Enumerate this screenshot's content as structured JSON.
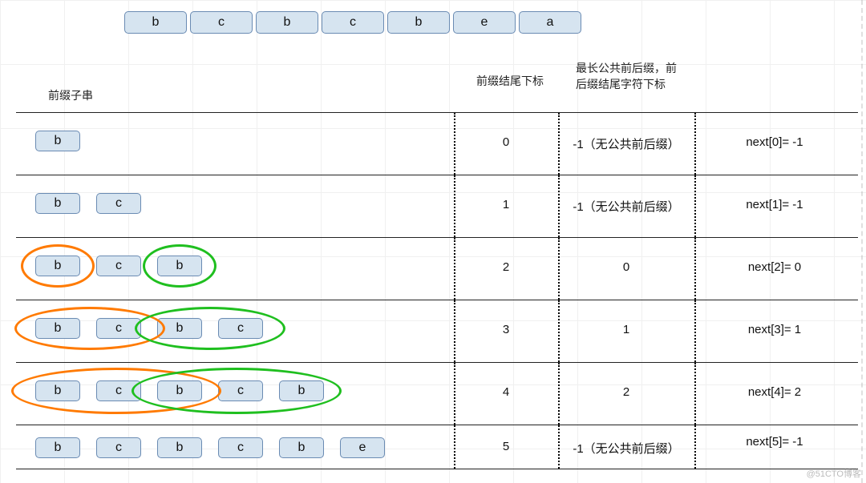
{
  "pattern": [
    "b",
    "c",
    "b",
    "c",
    "b",
    "e",
    "a"
  ],
  "headers": {
    "prefix": "前缀子串",
    "idx": "前缀结尾下标",
    "lps": "最长公共前后缀，前后缀结尾字符下标"
  },
  "rows": [
    {
      "cells": [
        "b"
      ],
      "idx": "0",
      "lps": "-1（无公共前后缀）",
      "next": "next[0]= -1"
    },
    {
      "cells": [
        "b",
        "c"
      ],
      "idx": "1",
      "lps": "-1（无公共前后缀）",
      "next": "next[1]= -1"
    },
    {
      "cells": [
        "b",
        "c",
        "b"
      ],
      "idx": "2",
      "lps": "0",
      "next": "next[2]= 0"
    },
    {
      "cells": [
        "b",
        "c",
        "b",
        "c"
      ],
      "idx": "3",
      "lps": "1",
      "next": "next[3]= 1"
    },
    {
      "cells": [
        "b",
        "c",
        "b",
        "c",
        "b"
      ],
      "idx": "4",
      "lps": "2",
      "next": "next[4]= 2"
    },
    {
      "cells": [
        "b",
        "c",
        "b",
        "c",
        "b",
        "e"
      ],
      "idx": "5",
      "lps": "-1（无公共前后缀）",
      "next": "next[5]= -1"
    }
  ],
  "watermark": "@51CTO博客"
}
